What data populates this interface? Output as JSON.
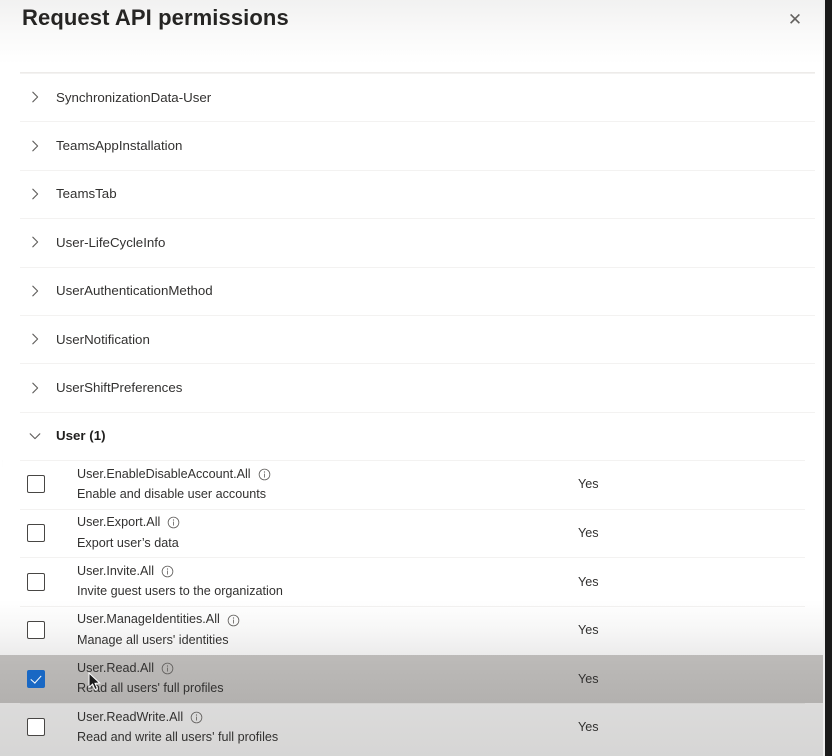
{
  "dialog": {
    "title": "Request API permissions",
    "close_label": "✕",
    "close_icon": "close-icon"
  },
  "collapsed_groups": [
    {
      "label": "SynchronizationData-User",
      "icon": "chevron-right-icon"
    },
    {
      "label": "TeamsAppInstallation",
      "icon": "chevron-right-icon"
    },
    {
      "label": "TeamsTab",
      "icon": "chevron-right-icon"
    },
    {
      "label": "User-LifeCycleInfo",
      "icon": "chevron-right-icon"
    },
    {
      "label": "UserAuthenticationMethod",
      "icon": "chevron-right-icon"
    },
    {
      "label": "UserNotification",
      "icon": "chevron-right-icon"
    },
    {
      "label": "UserShiftPreferences",
      "icon": "chevron-right-icon"
    }
  ],
  "expanded_group": {
    "label": "User (1)",
    "icon": "chevron-down-icon"
  },
  "permissions": [
    {
      "name": "User.EnableDisableAccount.All",
      "description": "Enable and disable user accounts",
      "admin_consent": "Yes",
      "checked": false,
      "selected": false,
      "info_icon": "info-icon"
    },
    {
      "name": "User.Export.All",
      "description": "Export user’s data",
      "admin_consent": "Yes",
      "checked": false,
      "selected": false,
      "info_icon": "info-icon"
    },
    {
      "name": "User.Invite.All",
      "description": "Invite guest users to the organization",
      "admin_consent": "Yes",
      "checked": false,
      "selected": false,
      "info_icon": "info-icon"
    },
    {
      "name": "User.ManageIdentities.All",
      "description": "Manage all users' identities",
      "admin_consent": "Yes",
      "checked": false,
      "selected": false,
      "info_icon": "info-icon"
    },
    {
      "name": "User.Read.All",
      "description": "Read all users' full profiles",
      "admin_consent": "Yes",
      "checked": true,
      "selected": true,
      "info_icon": "info-icon"
    },
    {
      "name": "User.ReadWrite.All",
      "description": "Read and write all users' full profiles",
      "admin_consent": "Yes",
      "checked": false,
      "selected": false,
      "info_icon": "info-icon"
    }
  ],
  "colors": {
    "checkbox_checked": "#1968c4",
    "row_selected_bg": "#c8c6c4",
    "text_primary": "#323130",
    "divider": "#f3f2f1"
  }
}
